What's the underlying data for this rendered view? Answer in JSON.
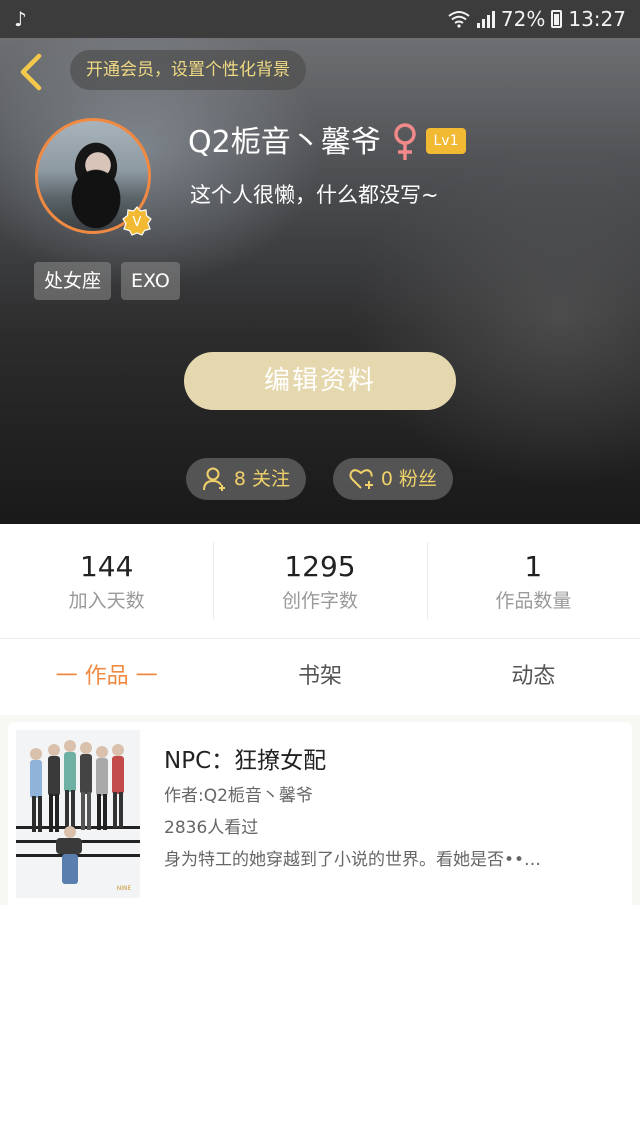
{
  "status_bar": {
    "battery": "72%",
    "time": "13:27",
    "icons": [
      "tiktok-icon",
      "wifi-icon",
      "signal-icon",
      "battery-icon"
    ]
  },
  "header": {
    "member_prompt": "开通会员，设置个性化背景",
    "nickname": "Q2栀音丶馨爷",
    "gender_icon": "female-icon",
    "level": "Lv1",
    "bio": "这个人很懒，什么都没写~",
    "tags": [
      "处女座",
      "EXO"
    ],
    "edit_button": "编辑资料",
    "follows": "8 关注",
    "fans": "0 粉丝",
    "accent_colors": {
      "gold": "#e5d8ae",
      "orange": "#f08a43",
      "level": "#f2b933"
    }
  },
  "stats": [
    {
      "value": "144",
      "label": "加入天数"
    },
    {
      "value": "1295",
      "label": "创作字数"
    },
    {
      "value": "1",
      "label": "作品数量"
    }
  ],
  "tabs": [
    {
      "label": "一 作品 一",
      "active": true
    },
    {
      "label": "书架",
      "active": false
    },
    {
      "label": "动态",
      "active": false
    }
  ],
  "works": [
    {
      "title": "NPC：狂撩女配",
      "author": "作者:Q2栀音丶馨爷",
      "views": "2836人看过",
      "description": "身为特工的她穿越到了小说的世界。看她是否••…"
    }
  ]
}
